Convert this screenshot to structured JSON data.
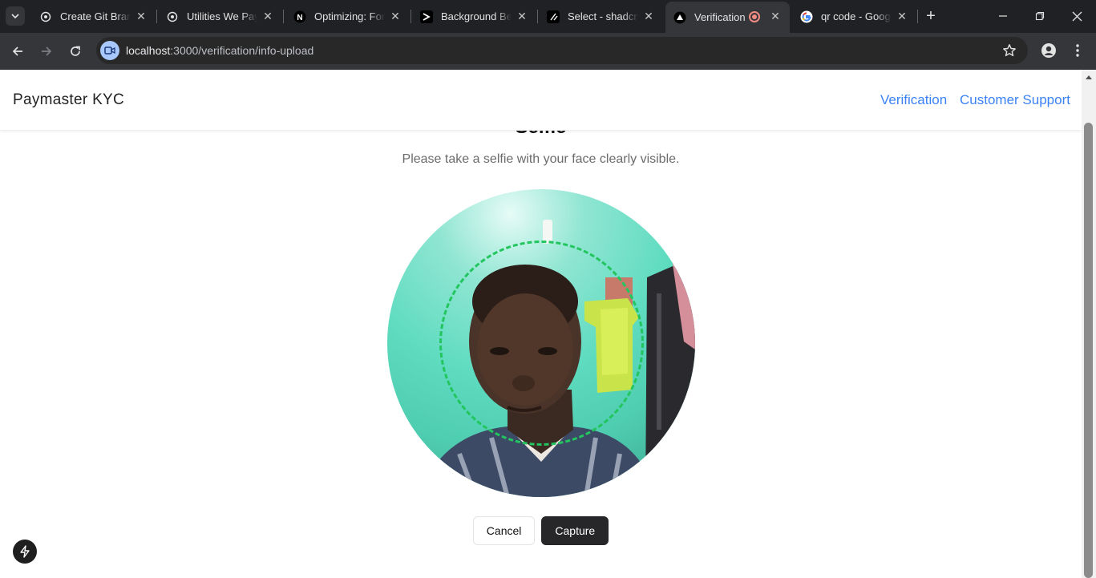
{
  "browser": {
    "tabs": [
      {
        "title": "Create Git Branch",
        "icon": "openai-icon",
        "active": false
      },
      {
        "title": "Utilities We Pay For",
        "icon": "openai-icon",
        "active": false
      },
      {
        "title": "Optimizing: Fonts",
        "icon": "nextjs-icon",
        "active": false
      },
      {
        "title": "Background Beams",
        "icon": "aceternity-icon",
        "active": false
      },
      {
        "title": "Select - shadcn/ui",
        "icon": "shadcn-icon",
        "active": false
      },
      {
        "title": "Verification",
        "icon": "vercel-triangle-icon",
        "active": true,
        "recording": true
      },
      {
        "title": "qr code - Google Search",
        "icon": "google-icon",
        "active": false
      }
    ],
    "url_host": "localhost",
    "url_path": ":3000/verification/info-upload"
  },
  "app": {
    "brand": "Paymaster KYC",
    "nav": [
      {
        "label": "Verification"
      },
      {
        "label": "Customer Support"
      }
    ]
  },
  "selfie": {
    "heading": "Selfie",
    "instructions": "Please take a selfie with your face clearly visible.",
    "camera_feed": "live-camera-preview",
    "guide_color": "#22c55e"
  },
  "actions": {
    "cancel_label": "Cancel",
    "capture_label": "Capture"
  },
  "colors": {
    "link": "#3b82f6",
    "primary_button": "#27272a",
    "browser_frame": "#202124"
  }
}
